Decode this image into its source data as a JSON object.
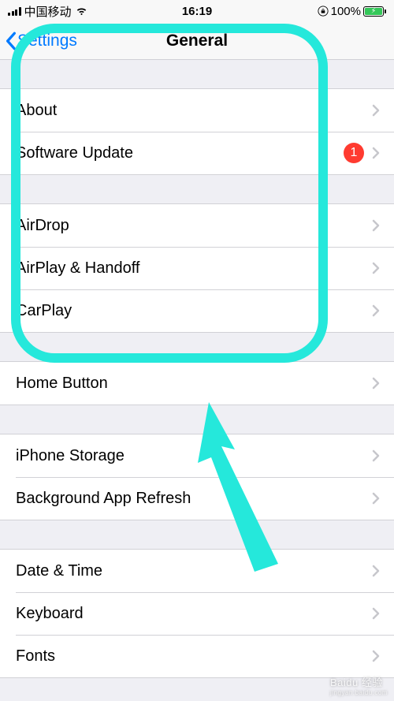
{
  "status": {
    "carrier": "中国移动",
    "time": "16:19",
    "battery_pct": "100%"
  },
  "nav": {
    "back_label": "Settings",
    "title": "General"
  },
  "groups": [
    {
      "rows": [
        {
          "label": "About",
          "badge": null
        },
        {
          "label": "Software Update",
          "badge": "1"
        }
      ]
    },
    {
      "rows": [
        {
          "label": "AirDrop",
          "badge": null
        },
        {
          "label": "AirPlay & Handoff",
          "badge": null
        },
        {
          "label": "CarPlay",
          "badge": null
        }
      ]
    },
    {
      "rows": [
        {
          "label": "Home Button",
          "badge": null
        }
      ]
    },
    {
      "rows": [
        {
          "label": "iPhone Storage",
          "badge": null
        },
        {
          "label": "Background App Refresh",
          "badge": null
        }
      ]
    },
    {
      "rows": [
        {
          "label": "Date & Time",
          "badge": null
        },
        {
          "label": "Keyboard",
          "badge": null
        },
        {
          "label": "Fonts",
          "badge": null
        }
      ]
    }
  ],
  "annotation": {
    "color": "#25e8db"
  },
  "watermark": {
    "main": "Baidu 经验",
    "sub": "jingyan.baidu.com"
  }
}
